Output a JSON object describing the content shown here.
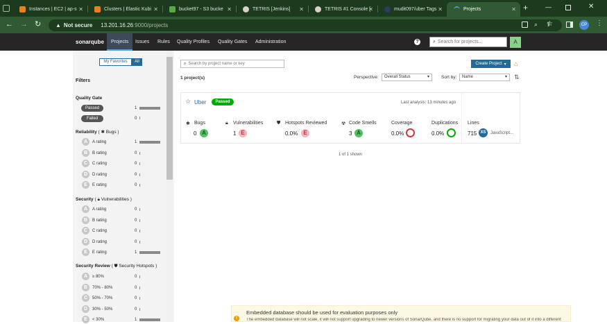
{
  "browser": {
    "tabs": [
      {
        "label": "Instances | EC2 | ap-s",
        "fav_color": "#e8821e"
      },
      {
        "label": "Clusters | Elastic Kubi",
        "fav_color": "#e8821e"
      },
      {
        "label": "bucket97 - S3 bucke",
        "fav_color": "#5aa84a"
      },
      {
        "label": "TETRIS [Jenkins]",
        "fav_color": "#d9d0c6"
      },
      {
        "label": "TETRIS #1 Console [",
        "fav_color": "#d9d0c6"
      },
      {
        "label": "mudit097/uber Tags",
        "fav_color": "#24415e"
      },
      {
        "label": "Projects",
        "fav_color": "#4b9fd5"
      }
    ],
    "not_secure": "Not secure",
    "url_host": "13.201.16.26",
    "url_path": ":9000/projects",
    "profile": "CP"
  },
  "sonar": {
    "logo": "sonarqube",
    "nav": [
      "Projects",
      "Issues",
      "Rules",
      "Quality Profiles",
      "Quality Gates",
      "Administration"
    ],
    "search_placeholder": "Search for projects...",
    "avatar": "A"
  },
  "filters": {
    "my_favorites": "My Favorites",
    "all": "All",
    "title": "Filters",
    "quality_gate": {
      "title": "Quality Gate",
      "passed": "Passed",
      "passed_count": "1",
      "failed": "Failed",
      "failed_count": "0"
    },
    "reliability": {
      "title": "Reliability",
      "sub": "Bugs",
      "items": [
        {
          "letter": "A",
          "label": "A rating",
          "count": "1"
        },
        {
          "letter": "B",
          "label": "B rating",
          "count": "0"
        },
        {
          "letter": "C",
          "label": "C rating",
          "count": "0"
        },
        {
          "letter": "D",
          "label": "D rating",
          "count": "0"
        },
        {
          "letter": "E",
          "label": "E rating",
          "count": "0"
        }
      ]
    },
    "security": {
      "title": "Security",
      "sub": "Vulnerabilities",
      "items": [
        {
          "letter": "A",
          "label": "A rating",
          "count": "0"
        },
        {
          "letter": "B",
          "label": "B rating",
          "count": "0"
        },
        {
          "letter": "C",
          "label": "C rating",
          "count": "0"
        },
        {
          "letter": "D",
          "label": "D rating",
          "count": "0"
        },
        {
          "letter": "E",
          "label": "E rating",
          "count": "1"
        }
      ]
    },
    "security_review": {
      "title": "Security Review",
      "sub": "Security Hotspots",
      "items": [
        {
          "letter": "A",
          "label": "≥ 80%",
          "count": "0"
        },
        {
          "letter": "B",
          "label": "70% - 80%",
          "count": "0"
        },
        {
          "letter": "C",
          "label": "50% - 70%",
          "count": "0"
        },
        {
          "letter": "D",
          "label": "30% - 50%",
          "count": "0"
        },
        {
          "letter": "E",
          "label": "< 30%",
          "count": "1"
        }
      ]
    }
  },
  "main": {
    "search_placeholder": "Search by project name or key",
    "create_project": "Create Project",
    "project_count": "1 project(s)",
    "perspective_label": "Perspective:",
    "perspective_value": "Overall Status",
    "sort_label": "Sort by:",
    "sort_value": "Name",
    "shown": "1 of 1 shown"
  },
  "project": {
    "name": "Uber",
    "gate": "Passed",
    "last_analysis": "Last analysis: 13 minutes ago",
    "bugs_label": "Bugs",
    "bugs": "0",
    "bugs_rating": "A",
    "vuln_label": "Vulnerabilities",
    "vuln": "1",
    "vuln_rating": "E",
    "hotspots_label": "Hotspots Reviewed",
    "hotspots": "0.0%",
    "hotspots_rating": "E",
    "smells_label": "Code Smells",
    "smells": "3",
    "smells_rating": "A",
    "coverage_label": "Coverage",
    "coverage": "0.0%",
    "dup_label": "Duplications",
    "dup": "0.0%",
    "lines_label": "Lines",
    "lines": "715",
    "size": "XS",
    "language": "JavaScript..."
  },
  "warning": {
    "title": "Embedded database should be used for evaluation purposes only",
    "body": "The embedded database will not scale, it will not support upgrading to newer versions of SonarQube, and there is no support for migrating your data out of it into a different"
  },
  "colors": {
    "passed": "#00aa00",
    "blue": "#236a97",
    "rating_a": "#55c063",
    "rating_e": "#f0b5bd"
  }
}
